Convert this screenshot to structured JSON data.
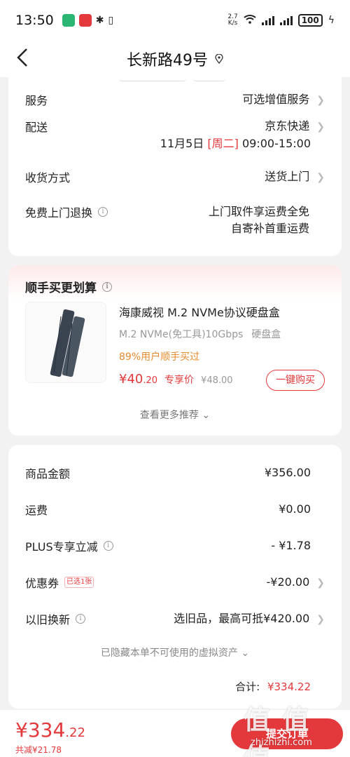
{
  "status_bar": {
    "time": "13:50",
    "speed_value": "2.7",
    "speed_unit": "K/s",
    "battery": "100"
  },
  "header": {
    "title": "长新路49号"
  },
  "order_info": {
    "service_label": "服务",
    "service_value": "可选增值服务",
    "delivery_label": "配送",
    "delivery_carrier": "京东快递",
    "delivery_date": "11月5日",
    "delivery_week": "[周二]",
    "delivery_time": "09:00-15:00",
    "receive_label": "收货方式",
    "receive_value": "送货上门",
    "return_label": "免费上门退换",
    "return_value_1": "上门取件享运费全免",
    "return_value_2": "自寄补首重运费"
  },
  "bundle": {
    "title": "顺手买更划算",
    "product_title": "海康威视 M.2 NVMe协议硬盘盒",
    "product_spec": "M.2 NVMe(免工具)10Gbps",
    "product_category": "硬盘盒",
    "product_hint": "89%用户顺手买过",
    "price_main": "¥40",
    "price_decimal": ".20",
    "price_tag": "专享价",
    "price_old": "¥48.00",
    "buy_label": "一键购买",
    "more_label": "查看更多推荐"
  },
  "summary": {
    "goods_label": "商品金额",
    "goods_value": "¥356.00",
    "freight_label": "运费",
    "freight_value": "¥0.00",
    "plus_label": "PLUS专享立减",
    "plus_value": "- ¥1.78",
    "coupon_label": "优惠券",
    "coupon_badge": "已选1张",
    "coupon_value": "-¥20.00",
    "tradein_label": "以旧换新",
    "tradein_value": "选旧品，最高可抵¥420.00",
    "hidden_note": "已隐藏本单不可使用的虚拟资产",
    "total_label": "合计:",
    "total_value": "¥334.22"
  },
  "bottom_bar": {
    "price_main": "¥334",
    "price_decimal": ".22",
    "saved": "共减¥21.78",
    "submit_label": "提交订单"
  },
  "watermark": {
    "glyphs": "值 值 值",
    "url": "zhizhizhi.com"
  },
  "colors": {
    "accent": "#e4393c",
    "hint_orange": "#e68a2e",
    "background": "#f2f2f2"
  }
}
